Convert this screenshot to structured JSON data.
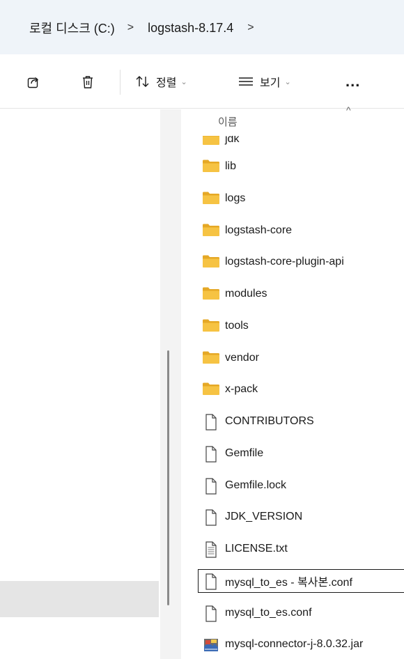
{
  "breadcrumb": {
    "items": [
      "로컬 디스크 (C:)",
      "logstash-8.17.4"
    ],
    "separator": ">"
  },
  "toolbar": {
    "share_icon": "share-icon",
    "delete_icon": "trash-icon",
    "sort_label": "정렬",
    "view_label": "보기",
    "more_label": "..."
  },
  "header": {
    "name_column": "이름"
  },
  "files": [
    {
      "name": "jdk",
      "type": "folder"
    },
    {
      "name": "lib",
      "type": "folder"
    },
    {
      "name": "logs",
      "type": "folder"
    },
    {
      "name": "logstash-core",
      "type": "folder"
    },
    {
      "name": "logstash-core-plugin-api",
      "type": "folder"
    },
    {
      "name": "modules",
      "type": "folder"
    },
    {
      "name": "tools",
      "type": "folder"
    },
    {
      "name": "vendor",
      "type": "folder"
    },
    {
      "name": "x-pack",
      "type": "folder"
    },
    {
      "name": "CONTRIBUTORS",
      "type": "file"
    },
    {
      "name": "Gemfile",
      "type": "file"
    },
    {
      "name": "Gemfile.lock",
      "type": "file"
    },
    {
      "name": "JDK_VERSION",
      "type": "file"
    },
    {
      "name": "LICENSE.txt",
      "type": "text"
    },
    {
      "name": "mysql_to_es - 복사본.conf",
      "type": "file",
      "selected": true
    },
    {
      "name": "mysql_to_es.conf",
      "type": "file"
    },
    {
      "name": "mysql-connector-j-8.0.32.jar",
      "type": "jar"
    }
  ],
  "colors": {
    "folder": "#f6c343",
    "folder_dark": "#e5a826",
    "breadcrumb_bg": "#eff4f9",
    "selection_bg": "#e5e5e5"
  }
}
